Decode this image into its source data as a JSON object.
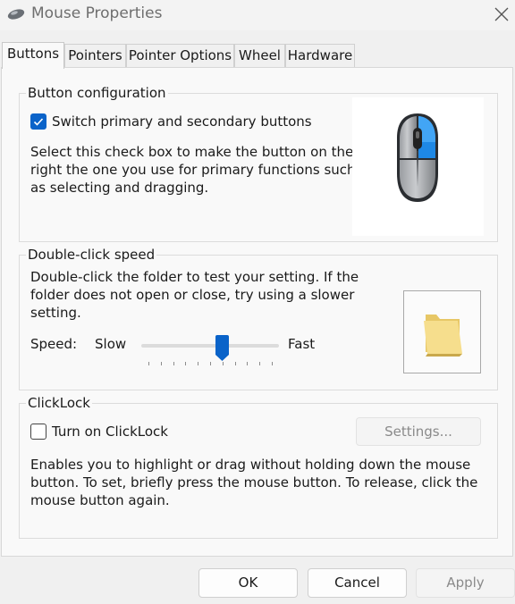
{
  "window": {
    "title": "Mouse Properties",
    "app_icon": "mouse-icon",
    "close_icon": "close-icon"
  },
  "tabs": [
    {
      "label": "Buttons",
      "active": true
    },
    {
      "label": "Pointers"
    },
    {
      "label": "Pointer Options"
    },
    {
      "label": "Wheel"
    },
    {
      "label": "Hardware"
    }
  ],
  "button_config": {
    "title": "Button configuration",
    "checkbox_label": "Switch primary and secondary buttons",
    "checked": true,
    "description": [
      "Select this check box to make the button on the",
      "right the one you use for primary functions such",
      "as selecting and dragging."
    ],
    "accent": "#0a63c9"
  },
  "double_click": {
    "title": "Double-click speed",
    "description": [
      "Double-click the folder to test your setting. If the",
      "folder does not open or close, try using a slower",
      "setting."
    ],
    "speed_label": "Speed:",
    "slow_label": "Slow",
    "fast_label": "Fast",
    "speed_level": 0.6,
    "tick_count": 11
  },
  "clicklock": {
    "title": "ClickLock",
    "checkbox_label": "Turn on ClickLock",
    "checked": false,
    "settings_label": "Settings...",
    "settings_enabled": false,
    "description": [
      "Enables you to highlight or drag without holding down the mouse",
      "button. To set, briefly press the mouse button. To release, click the",
      "mouse button again."
    ]
  },
  "footer": {
    "ok_label": "OK",
    "cancel_label": "Cancel",
    "apply_label": "Apply",
    "apply_enabled": false
  }
}
